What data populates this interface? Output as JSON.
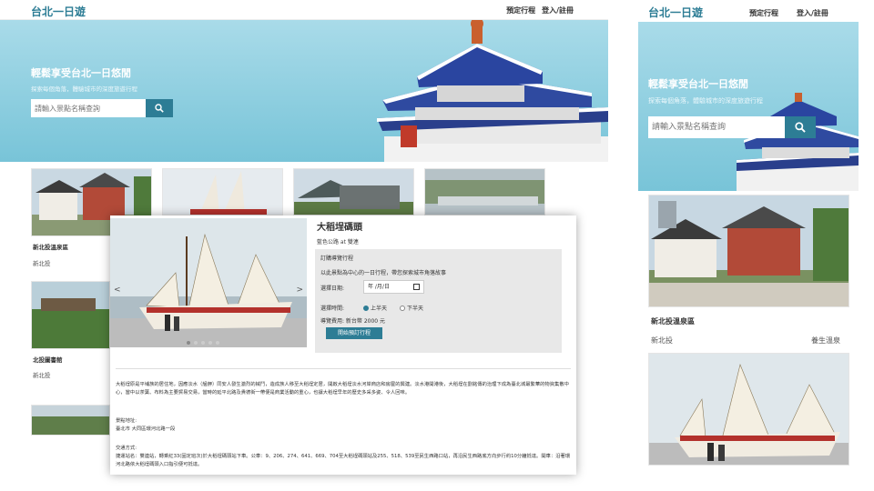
{
  "app": {
    "brand": "台北一日遊",
    "nav": {
      "booking": "預定行程",
      "login": "登入/註冊"
    }
  },
  "hero": {
    "title": "輕鬆享受台北一日悠閒",
    "subtitle": "探索每個角落，體驗城市的深度旅遊行程",
    "search_placeholder": "請輸入景點名稱查詢",
    "search_icon": "search-icon"
  },
  "attractions": [
    {
      "title": "新北投溫泉區",
      "location": "新北投",
      "category": "養生溫泉"
    },
    {
      "title": "大稻埕碼頭",
      "location": "",
      "category": ""
    },
    {
      "title": "",
      "location": "",
      "category": ""
    },
    {
      "title": "",
      "location": "",
      "category": ""
    },
    {
      "title": "北投圖書館",
      "location": "新北投",
      "category": ""
    }
  ],
  "modal": {
    "title": "大稻埕碼頭",
    "subtitle": "藍色公路 at 雙連",
    "booking": {
      "heading": "訂購導覽行程",
      "description": "以此景點為中心的一日行程，帶您探索城市角落故事",
      "date_label": "選擇日期:",
      "date_value": "年 /月/日",
      "time_label": "選擇時間:",
      "time_options": [
        "上半天",
        "下半天"
      ],
      "fee": "導覽費用: 新台幣 2000 元",
      "cta": "開始預訂行程"
    },
    "description": "大稻埕原是平埔族的居住地，因應淡水（艋舺）同安人發生激烈的械鬥，造成族人移至大稻埕定居，開啟大稻埕淡水河岸商店和房屋的興建。淡水港開港後，大稻埕在劉銘傳的治理下成為臺北城最繁華的物資集散中心，當中以茶葉、布料為主要貿易交易，當時的延平北路及貴德街一帶便是商業活動的重心，也讓大稻埕早年的歷史多采多姿、令人回味。",
    "address_label": "景點地址:",
    "address": "臺北市 大同區環河北路一段",
    "transport_label": "交通方式:",
    "transport": "捷運站名：雙連站，轉乘紅33(固定班次)於大稻埕碼頭站下車。公車：9、206、274、641、669、704至大稻埕碼頭站及255、518、539至民生西路口站，再沿民生西路底方向步行約10分鐘抵達。開車：沿著環河北路依大稻埕碼頭入口指引便可抵達。"
  },
  "colors": {
    "accent": "#2d7d95",
    "hero": "#8fd0e1"
  }
}
